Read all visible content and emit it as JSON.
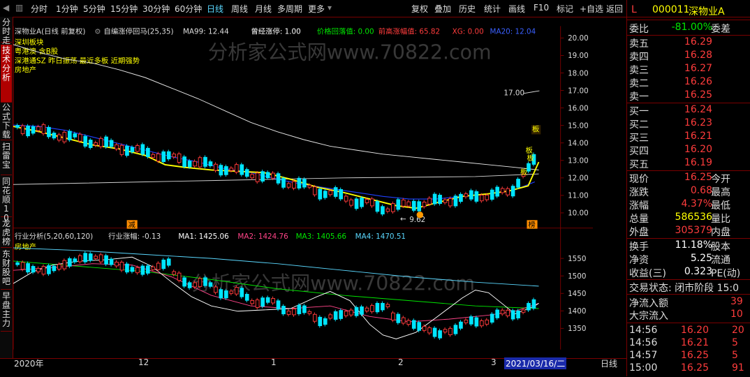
{
  "toolbar": {
    "left_items": [
      "分时",
      "1分钟",
      "5分钟",
      "15分钟",
      "30分钟",
      "60分钟",
      "日线",
      "周线",
      "月线",
      "多周期",
      "更多"
    ],
    "right_items": [
      "复权",
      "叠加",
      "历史",
      "统计",
      "画线",
      "F10",
      "标记",
      "+自选",
      "返回"
    ]
  },
  "left_tabs": [
    "分时走势",
    "技术分析",
    "公式下载",
    "扫雷宝",
    "同花顺10",
    "龙虎榜",
    "东财股吧",
    "早盘主力"
  ],
  "main_chart": {
    "title": "深物业A(日线 前复权)",
    "indicator": "自编涨停回马(25,35)",
    "ma99": "MA99: 12.44",
    "zt": "曾经涨停: 1.00",
    "pullback": "价格回落值: 0.00",
    "prev_high": "前高涨幅值: 65.82",
    "xg": "XG: 0.00",
    "ma20": "MA20: 12.04",
    "sectors": [
      "深圳板块",
      "粤港澳 含B股",
      "深港通SZ 昨日振荡 最近多板 近期强势",
      "房地产"
    ],
    "y_labels": [
      "20.00",
      "19.00",
      "18.00",
      "17.00",
      "16.00",
      "15.00",
      "14.00",
      "13.00",
      "12.00",
      "11.00",
      "10.00"
    ],
    "high_label": "17.00",
    "low_label": "9.62",
    "ban_labels": [
      "板",
      "板",
      "板",
      "板"
    ],
    "jian_label": "减",
    "bang_label": "榜"
  },
  "sub_chart": {
    "title": "行业分析(5,20,60,120)",
    "change": "行业涨幅: -0.13",
    "ma1": "MA1: 1425.06",
    "ma2": "MA2: 1424.76",
    "ma3": "MA3: 1405.66",
    "ma4": "MA4: 1470.51",
    "sector": "房地产",
    "y_labels": [
      "1550",
      "1500",
      "1450",
      "1400",
      "1350"
    ]
  },
  "bottom": {
    "year": "2020年",
    "m12": "12",
    "m1": "1",
    "m2": "2",
    "m3": "3",
    "date": "2021/03/16/二",
    "period": "日线"
  },
  "watermark": "分析家公式网www.70822.com",
  "quote": {
    "flag": "L",
    "code": "000011",
    "name": "深物业A",
    "weibi_label": "委比",
    "weibi": "-81.00%",
    "weicha_label": "委差",
    "sells": [
      {
        "label": "卖五",
        "price": "16.29"
      },
      {
        "label": "卖四",
        "price": "16.28"
      },
      {
        "label": "卖三",
        "price": "16.27"
      },
      {
        "label": "卖二",
        "price": "16.26"
      },
      {
        "label": "卖一",
        "price": "16.25"
      }
    ],
    "buys": [
      {
        "label": "买一",
        "price": "16.24"
      },
      {
        "label": "买二",
        "price": "16.23"
      },
      {
        "label": "买三",
        "price": "16.21"
      },
      {
        "label": "买四",
        "price": "16.20"
      },
      {
        "label": "买五",
        "price": "16.19"
      }
    ],
    "stats": [
      {
        "l": "现价",
        "v": "16.25",
        "c": "red",
        "r": "今开"
      },
      {
        "l": "涨跌",
        "v": "0.68",
        "c": "red",
        "r": "最高"
      },
      {
        "l": "涨幅",
        "v": "4.37%",
        "c": "red",
        "r": "最低"
      },
      {
        "l": "总量",
        "v": "586536",
        "c": "yellow",
        "r": "量比"
      },
      {
        "l": "外盘",
        "v": "305379",
        "c": "red",
        "r": "内盘"
      }
    ],
    "stats2": [
      {
        "l": "换手",
        "v": "11.18%",
        "r": "股本"
      },
      {
        "l": "净资",
        "v": "5.25",
        "r": "流通"
      },
      {
        "l": "收益(三)",
        "v": "0.323",
        "r": "PE(动)"
      }
    ],
    "status": "交易状态: 闭市阶段 15:0",
    "netflow_label": "净流入额",
    "netflow": "39",
    "block_label": "大宗流入",
    "block": "10",
    "ticks": [
      {
        "t": "14:56",
        "p": "16.20",
        "v": "20"
      },
      {
        "t": "14:56",
        "p": "16.21",
        "v": "5"
      },
      {
        "t": "14:57",
        "p": "16.25",
        "v": "5"
      },
      {
        "t": "15:00",
        "p": "16.25",
        "v": "91"
      }
    ]
  }
}
